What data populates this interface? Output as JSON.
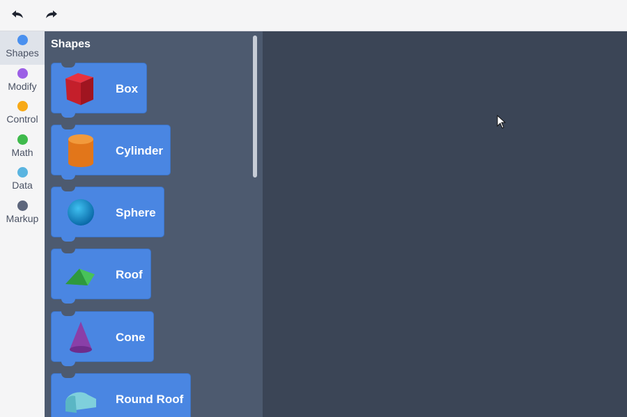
{
  "toolbar": {
    "undo_icon": "undo-arrow",
    "redo_icon": "redo-arrow"
  },
  "categories": [
    {
      "label": "Shapes",
      "color": "#4a90ef",
      "selected": true
    },
    {
      "label": "Modify",
      "color": "#9c5fe6",
      "selected": false
    },
    {
      "label": "Control",
      "color": "#f7a917",
      "selected": false
    },
    {
      "label": "Math",
      "color": "#3fba4c",
      "selected": false
    },
    {
      "label": "Data",
      "color": "#5ab4e0",
      "selected": false
    },
    {
      "label": "Markup",
      "color": "#5d667c",
      "selected": false
    }
  ],
  "flyout": {
    "title": "Shapes",
    "blocks": [
      {
        "label": "Box",
        "icon": "box-icon"
      },
      {
        "label": "Cylinder",
        "icon": "cylinder-icon"
      },
      {
        "label": "Sphere",
        "icon": "sphere-icon"
      },
      {
        "label": "Roof",
        "icon": "roof-icon"
      },
      {
        "label": "Cone",
        "icon": "cone-icon"
      },
      {
        "label": "Round Roof",
        "icon": "round-roof-icon"
      }
    ]
  },
  "colors": {
    "accent": "#4a86e2",
    "flyout_bg": "#4d5a6f",
    "workspace_bg": "#3b4556"
  }
}
